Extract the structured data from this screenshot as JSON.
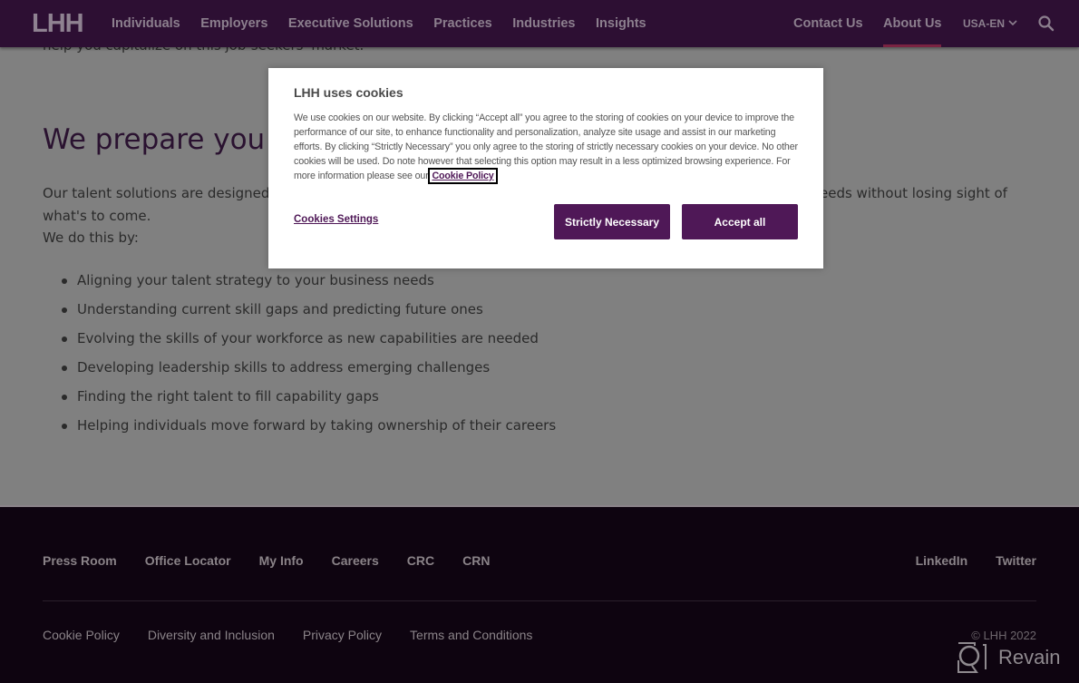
{
  "header": {
    "logo": "LHH",
    "nav": [
      "Individuals",
      "Employers",
      "Executive Solutions",
      "Practices",
      "Industries",
      "Insights"
    ],
    "nav_right": [
      "Contact Us",
      "About Us"
    ],
    "active_item": "About Us",
    "locale": "USA-EN",
    "chevron": "⌄"
  },
  "main": {
    "cutoff_text": "help you capitalize on this job-seekers' market.",
    "heading": "We prepare you fo",
    "para_left": "Our talent solutions are designed to",
    "para_right": "eeds without losing sight of",
    "para_line2": "what's to come.",
    "para_line3": "We do this by:",
    "list": [
      "Aligning your talent strategy to your business needs",
      "Understanding current skill gaps and predicting future ones",
      "Evolving the skills of your workforce as new capabilities are needed",
      "Developing leadership skills to address emerging challenges",
      "Finding the right talent to fill capability gaps",
      "Helping individuals move forward by taking ownership of their careers"
    ]
  },
  "cookie_modal": {
    "title": "LHH uses cookies",
    "body": "We use cookies on our website. By clicking “Accept all” you agree to the storing of cookies on your device to improve the performance of our site, to enhance functionality and personalization, analyze site usage and assist in our marketing efforts. By clicking “Strictly Necessary” you only agree to the storing of strictly necessary cookies on your device. No other cookies will be used. Do note however that selecting this option may result in a less optimized browsing experience. For more information please see our ",
    "policy_link": "Cookie Policy",
    "settings_link": "Cookies Settings",
    "strict_button": "Strictly Necessary",
    "accept_button": "Accept all"
  },
  "footer": {
    "links": [
      "Press Room",
      "Office Locator",
      "My Info",
      "Careers",
      "CRC",
      "CRN"
    ],
    "social": [
      "LinkedIn",
      "Twitter"
    ],
    "legal": [
      "Cookie Policy",
      "Diversity and Inclusion",
      "Privacy Policy",
      "Terms and Conditions"
    ],
    "copyright": "© LHH 2022"
  },
  "watermark": {
    "text": "Revain"
  },
  "colors": {
    "header_bg": "#2d0f33",
    "footer_bg": "#0e0410",
    "brand_purple": "#4f1857",
    "active_underline": "#7a2342",
    "overlay_gray": "#808080"
  }
}
